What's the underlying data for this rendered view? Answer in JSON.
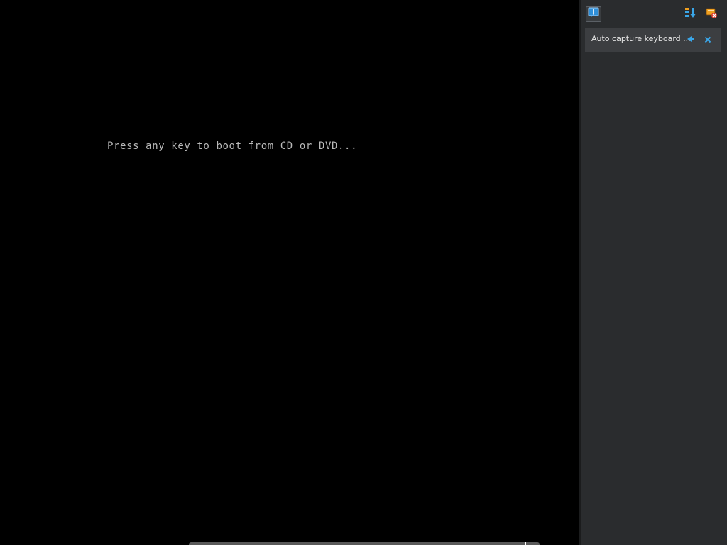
{
  "vm_screen": {
    "boot_message": "Press any key to boot from CD or DVD..."
  },
  "notification_panel": {
    "header_icons": [
      "messages-icon",
      "sort-icon",
      "clear-all-icon"
    ],
    "items": [
      {
        "text": "Auto capture keyboard ...",
        "icons": [
          "pin-icon",
          "close-icon"
        ]
      }
    ]
  },
  "colors": {
    "screen_bg": "#000000",
    "boot_text": "#b8b8b8",
    "panel_bg": "#2a2c2e",
    "item_bg": "#3c3e41",
    "accent_blue": "#3aa6e8"
  }
}
